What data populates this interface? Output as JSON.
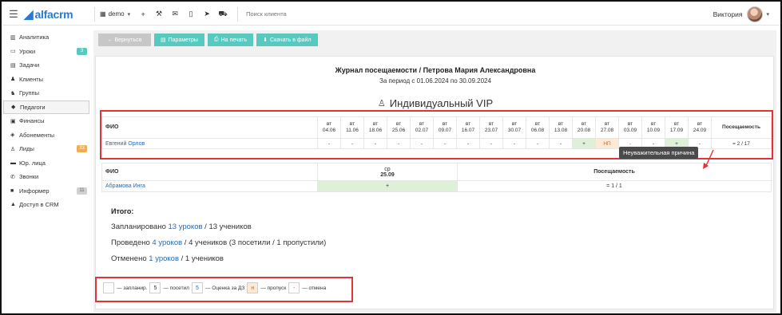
{
  "app": {
    "logo_text": "alfacrm",
    "account": "demo",
    "search_placeholder": "Поиск клиента",
    "user_name": "Виктория",
    "brand_color": "#2a7bd0"
  },
  "sidebar": {
    "items": [
      {
        "icon": "chart-icon",
        "label": "Аналитика",
        "badge": ""
      },
      {
        "icon": "calendar-icon",
        "label": "Уроки",
        "badge": "3"
      },
      {
        "icon": "tasks-icon",
        "label": "Задачи",
        "badge": ""
      },
      {
        "icon": "user-icon",
        "label": "Клиенты",
        "badge": ""
      },
      {
        "icon": "users-icon",
        "label": "Группы",
        "badge": ""
      },
      {
        "icon": "graduation-cap-icon",
        "label": "Педагоги",
        "badge": ""
      },
      {
        "icon": "money-icon",
        "label": "Финансы",
        "badge": ""
      },
      {
        "icon": "tag-icon",
        "label": "Абонементы",
        "badge": ""
      },
      {
        "icon": "user-plus-icon",
        "label": "Лиды",
        "badge": "33"
      },
      {
        "icon": "briefcase-icon",
        "label": "Юр. лица",
        "badge": ""
      },
      {
        "icon": "phone-icon",
        "label": "Звонки",
        "badge": ""
      },
      {
        "icon": "informer-icon",
        "label": "Информер",
        "badge": "11"
      },
      {
        "icon": "lock-icon",
        "label": "Доступ в CRM",
        "badge": ""
      }
    ],
    "badge_colors": {
      "Уроки": "#58c9bf",
      "Лиды": "#f0ad4e",
      "Информер": "#d0d0d0"
    }
  },
  "toolbar": {
    "back_label": "← Вернуться",
    "params_label": "Параметры",
    "print_label": "На печать",
    "download_label": "Скачать в файл"
  },
  "journal": {
    "title": "Журнал посещаемости / Петрова Мария Александровна",
    "period": "За период с 01.06.2024 по 30.09.2024",
    "group_title": "Индивидуальный VIP"
  },
  "table1": {
    "fio_header": "ФИО",
    "attendance_header": "Посещаемость",
    "dates": [
      {
        "day": "вт",
        "date": "04.06"
      },
      {
        "day": "вт",
        "date": "11.06"
      },
      {
        "day": "вт",
        "date": "18.06"
      },
      {
        "day": "вт",
        "date": "25.06"
      },
      {
        "day": "вт",
        "date": "02.07"
      },
      {
        "day": "вт",
        "date": "09.07"
      },
      {
        "day": "вт",
        "date": "16.07"
      },
      {
        "day": "вт",
        "date": "23.07"
      },
      {
        "day": "вт",
        "date": "30.07"
      },
      {
        "day": "вт",
        "date": "06.08"
      },
      {
        "day": "вт",
        "date": "13.08"
      },
      {
        "day": "вт",
        "date": "20.08"
      },
      {
        "day": "вт",
        "date": "27.08"
      },
      {
        "day": "вт",
        "date": "03.09"
      },
      {
        "day": "вт",
        "date": "10.09"
      },
      {
        "day": "вт",
        "date": "17.09"
      },
      {
        "day": "вт",
        "date": "24.09"
      }
    ],
    "row": {
      "name": "Евгений Орлов",
      "cells": [
        "-",
        "-",
        "-",
        "-",
        "-",
        "-",
        "-",
        "-",
        "-",
        "-",
        "-",
        "+",
        "НП",
        "-",
        "-",
        "+",
        "-"
      ],
      "total": "= 2 / 17"
    },
    "tooltip": "Неуважительная причина"
  },
  "table2": {
    "fio_header": "ФИО",
    "date_day": "ср",
    "date": "25.09",
    "attendance_header": "Посещаемость",
    "row": {
      "name": "Абрамова Инга",
      "cell": "+",
      "total": "= 1 / 1"
    }
  },
  "summary": {
    "title": "Итого:",
    "planned_prefix": "Запланировано",
    "planned_link": "13 уроков",
    "planned_suffix": "/ 13 учеников",
    "held_prefix": "Проведено",
    "held_link": "4 уроков",
    "held_suffix": "/ 4 учеников (3 посетили / 1 пропустили)",
    "cancelled_prefix": "Отменено",
    "cancelled_link": "1 уроков",
    "cancelled_suffix": "/ 1 учеников"
  },
  "legend": {
    "box1": "",
    "label1": "— запланир.",
    "box2": "5",
    "label2": "— посетил",
    "box3": "5",
    "label3": "— Оценка за ДЗ",
    "box4": "н",
    "label4": "— пропуск",
    "box5": "-",
    "label5": "— отмена"
  }
}
